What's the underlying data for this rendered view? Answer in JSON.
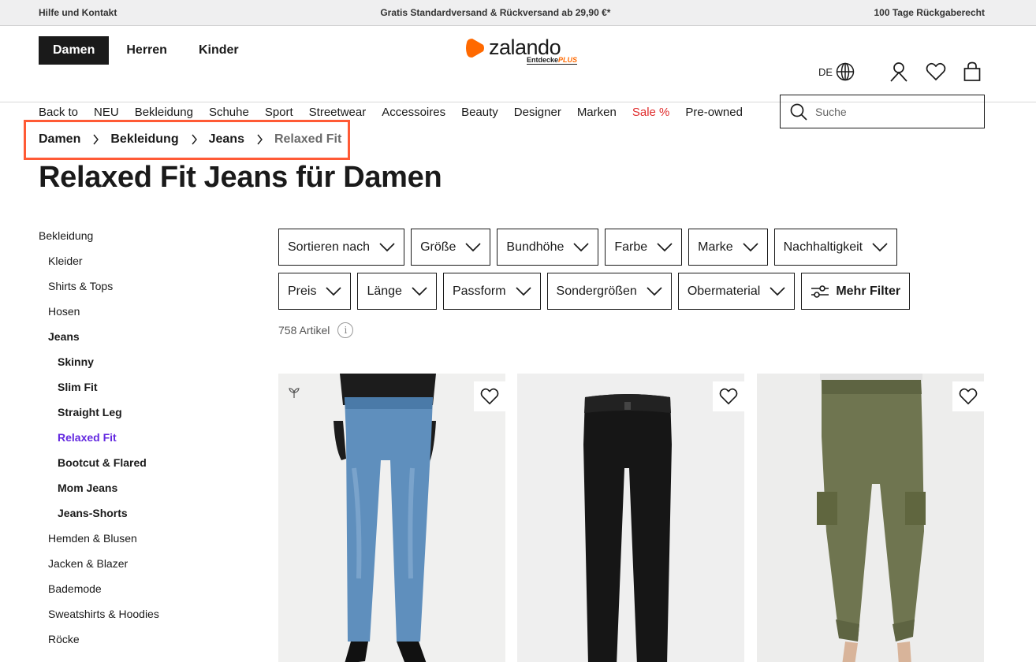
{
  "topbar": {
    "help": "Hilfe und Kontakt",
    "shipping": "Gratis Standardversand & Rückversand ab 29,90 €*",
    "returns": "100 Tage Rückgaberecht"
  },
  "gender_nav": [
    "Damen",
    "Herren",
    "Kinder"
  ],
  "logo": {
    "name": "zalando",
    "sub": "Entdecke",
    "plus": "PLUS",
    "brand_color": "#ff6900"
  },
  "header_icons": {
    "lang": "DE"
  },
  "category_nav": [
    "Back to",
    "NEU",
    "Bekleidung",
    "Schuhe",
    "Sport",
    "Streetwear",
    "Accessoires",
    "Beauty",
    "Designer",
    "Marken",
    "Sale %",
    "Pre-owned"
  ],
  "search": {
    "placeholder": "Suche"
  },
  "breadcrumb": [
    "Damen",
    "Bekleidung",
    "Jeans",
    "Relaxed Fit"
  ],
  "page_title": "Relaxed Fit Jeans für Damen",
  "sidebar": [
    "Bekleidung",
    "Kleider",
    "Shirts & Tops",
    "Hosen",
    "Jeans",
    "Skinny",
    "Slim Fit",
    "Straight Leg",
    "Relaxed Fit",
    "Bootcut & Flared",
    "Mom Jeans",
    "Jeans-Shorts",
    "Hemden & Blusen",
    "Jacken & Blazer",
    "Bademode",
    "Sweatshirts & Hoodies",
    "Röcke"
  ],
  "filters_row1": [
    "Sortieren nach",
    "Größe",
    "Bundhöhe",
    "Farbe",
    "Marke",
    "Nachhaltigkeit"
  ],
  "filters_row2": [
    "Preis",
    "Länge",
    "Passform",
    "Sondergrößen",
    "Obermaterial"
  ],
  "more_filters": "Mehr Filter",
  "article_count": "758 Artikel",
  "colors": {
    "accent_active": "#6328e0",
    "sale": "#e02b2b",
    "highlight": "#ff5a35"
  }
}
